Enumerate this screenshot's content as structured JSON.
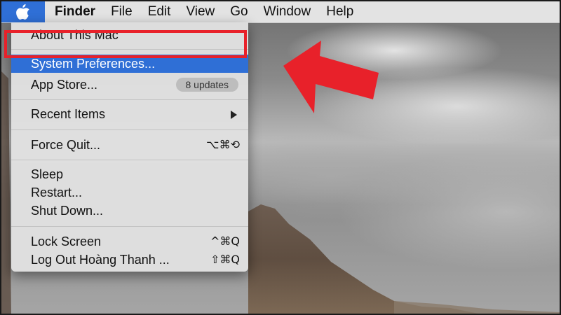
{
  "menubar": {
    "apple_icon": "apple-logo-icon",
    "app_name": "Finder",
    "menus": [
      "File",
      "Edit",
      "View",
      "Go",
      "Window",
      "Help"
    ]
  },
  "apple_menu": {
    "about": "About This Mac",
    "system_preferences": "System Preferences...",
    "app_store": "App Store...",
    "app_store_badge": "8 updates",
    "recent_items": "Recent Items",
    "force_quit": "Force Quit...",
    "force_quit_shortcut": "⌥⌘⟲",
    "sleep": "Sleep",
    "restart": "Restart...",
    "shut_down": "Shut Down...",
    "lock_screen": "Lock Screen",
    "lock_screen_shortcut": "^⌘Q",
    "log_out": "Log Out Hoàng Thanh ...",
    "log_out_shortcut": "⇧⌘Q"
  },
  "colors": {
    "selection": "#2f6fd6",
    "annotation": "#e8212a"
  }
}
